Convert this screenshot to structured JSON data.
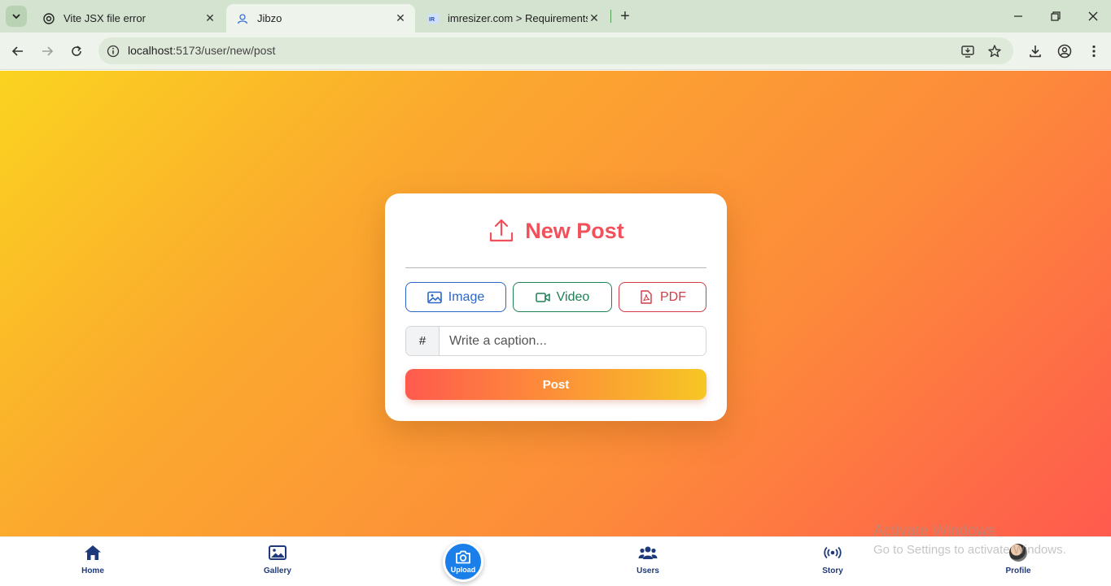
{
  "browser": {
    "tabs": [
      {
        "title": "Vite JSX file error",
        "active": false
      },
      {
        "title": "Jibzo",
        "active": true
      },
      {
        "title": "imresizer.com > Requirements",
        "active": false
      }
    ],
    "url_host": "localhost",
    "url_path": ":5173/user/new/post",
    "close_glyph": "✕",
    "new_tab_glyph": "+"
  },
  "card": {
    "title": "New Post",
    "buttons": {
      "image": "Image",
      "video": "Video",
      "pdf": "PDF"
    },
    "caption": {
      "prefix": "#",
      "placeholder": "Write a caption...",
      "value": ""
    },
    "post_button": "Post"
  },
  "bottom_nav": {
    "home": "Home",
    "gallery": "Gallery",
    "upload": "Upload",
    "users": "Users",
    "story": "Story",
    "profile": "Profile"
  },
  "watermark": {
    "line1": "Activate Windows",
    "line2": "Go to Settings to activate Windows."
  },
  "colors": {
    "accent_red": "#f2505a",
    "image_blue": "#2a66c7",
    "video_green": "#1d8055",
    "pdf_red": "#d23a46",
    "nav_blue": "#1f3a7a",
    "upload_fab": "#1a7fe8"
  }
}
